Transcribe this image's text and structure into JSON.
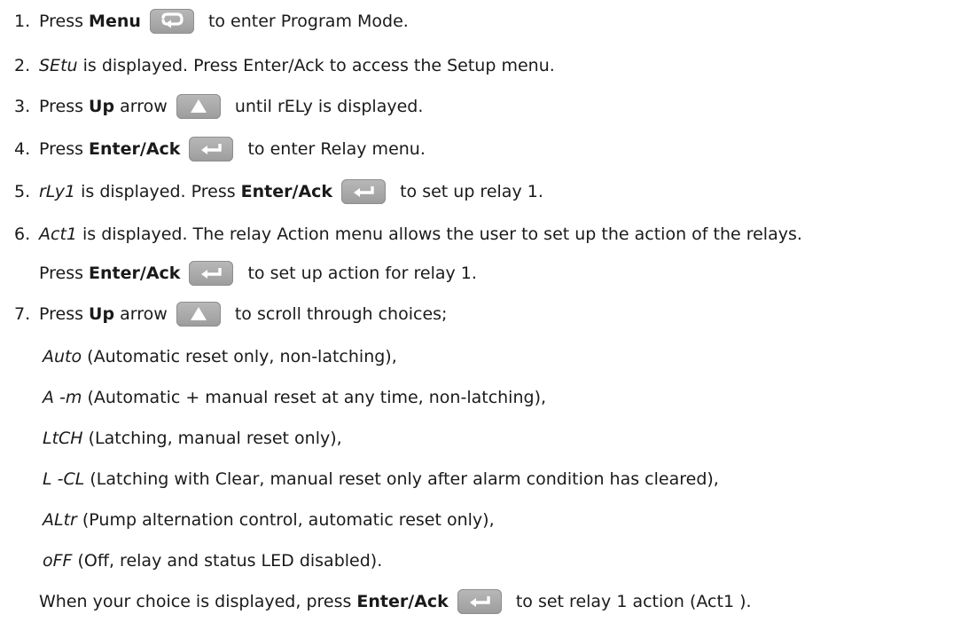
{
  "steps": [
    {
      "n": "1.",
      "a": "Press ",
      "b": "Menu",
      "c": " to enter Program Mode."
    },
    {
      "n": "2.",
      "a": "SEtu",
      "b": " is displayed. Press Enter/Ack to access the Setup menu."
    },
    {
      "n": "3.",
      "a": "Press ",
      "b": "Up",
      "c": " arrow",
      "d": " until rELy is displayed."
    },
    {
      "n": "4.",
      "a": "Press ",
      "b": "Enter/Ack",
      "c": " to enter Relay menu."
    },
    {
      "n": "5.",
      "a": "rLy1",
      "b": " is displayed. Press ",
      "c": "Enter/Ack",
      "d": " to set up relay 1."
    },
    {
      "n": "6.",
      "a": "Act1",
      "b": " is displayed. The relay Action menu allows the user to set up the action of the relays.",
      "c": "Press ",
      "d": "Enter/Ack",
      "e": " to set up action for relay 1."
    },
    {
      "n": "7.",
      "a": "Press ",
      "b": "Up",
      "c": " arrow",
      "d": " to scroll through choices;"
    }
  ],
  "choices": [
    {
      "code": "Auto",
      "desc": " (Automatic reset only, non-latching),"
    },
    {
      "code": "A -m",
      "desc": " (Automatic + manual reset at any time, non-latching),"
    },
    {
      "code": "LtCH",
      "desc": " (Latching, manual reset only),"
    },
    {
      "code": "L -CL",
      "desc": " (Latching with Clear, manual reset only after alarm condition has cleared),"
    },
    {
      "code": "ALtr",
      "desc": " (Pump alternation control, automatic reset only),"
    },
    {
      "code": "oFF",
      "desc": " (Off, relay and status LED disabled)."
    }
  ],
  "final": {
    "a": "When your choice is displayed, press ",
    "b": "Enter/Ack",
    "c": " to set relay 1 action (Act1 )."
  },
  "icons": {
    "menu": "menu-loop-icon",
    "up": "up-arrow-icon",
    "enter": "enter-arrow-icon"
  },
  "colors": {
    "key_face": "#a8a8a8",
    "glyph": "#ffffff",
    "text": "#1a1a1a"
  }
}
